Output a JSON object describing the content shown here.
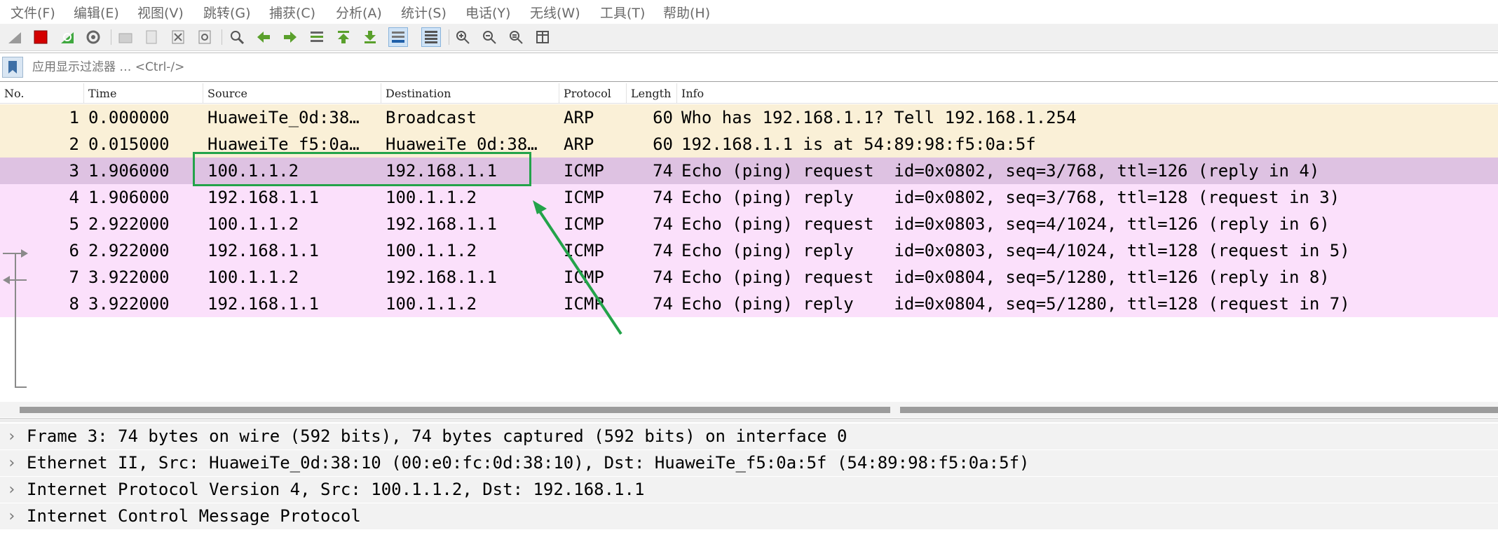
{
  "menu": [
    "文件(F)",
    "编辑(E)",
    "视图(V)",
    "跳转(G)",
    "捕获(C)",
    "分析(A)",
    "统计(S)",
    "电话(Y)",
    "无线(W)",
    "工具(T)",
    "帮助(H)"
  ],
  "toolbar": {
    "icons": [
      "shark-fin-start-icon",
      "stop-capture-icon",
      "restart-capture-icon",
      "capture-options-icon",
      "open-file-icon",
      "save-file-icon",
      "close-file-icon",
      "reload-file-icon",
      "find-packet-icon",
      "go-back-icon",
      "go-forward-icon",
      "go-to-packet-icon",
      "go-first-icon",
      "go-last-icon",
      "autoscroll-icon",
      "colorize-icon",
      "zoom-in-icon",
      "zoom-out-icon",
      "zoom-normal-icon",
      "resize-columns-icon"
    ]
  },
  "filter": {
    "placeholder": "应用显示过滤器 … <Ctrl-/>"
  },
  "columns": [
    "No.",
    "Time",
    "Source",
    "Destination",
    "Protocol",
    "Length",
    "Info"
  ],
  "packets": [
    {
      "no": "1",
      "time": "0.000000",
      "src": "HuaweiTe_0d:38…",
      "dst": "Broadcast",
      "proto": "ARP",
      "len": "60",
      "info": "Who has 192.168.1.1? Tell 192.168.1.254",
      "type": "arp"
    },
    {
      "no": "2",
      "time": "0.015000",
      "src": "HuaweiTe_f5:0a…",
      "dst": "HuaweiTe_0d:38…",
      "proto": "ARP",
      "len": "60",
      "info": "192.168.1.1 is at 54:89:98:f5:0a:5f",
      "type": "arp"
    },
    {
      "no": "3",
      "time": "1.906000",
      "src": "100.1.1.2",
      "dst": "192.168.1.1",
      "proto": "ICMP",
      "len": "74",
      "info": "Echo (ping) request  id=0x0802, seq=3/768, ttl=126 (reply in 4)",
      "type": "sel"
    },
    {
      "no": "4",
      "time": "1.906000",
      "src": "192.168.1.1",
      "dst": "100.1.1.2",
      "proto": "ICMP",
      "len": "74",
      "info": "Echo (ping) reply    id=0x0802, seq=3/768, ttl=128 (request in 3)",
      "type": "icmp"
    },
    {
      "no": "5",
      "time": "2.922000",
      "src": "100.1.1.2",
      "dst": "192.168.1.1",
      "proto": "ICMP",
      "len": "74",
      "info": "Echo (ping) request  id=0x0803, seq=4/1024, ttl=126 (reply in 6)",
      "type": "icmp"
    },
    {
      "no": "6",
      "time": "2.922000",
      "src": "192.168.1.1",
      "dst": "100.1.1.2",
      "proto": "ICMP",
      "len": "74",
      "info": "Echo (ping) reply    id=0x0803, seq=4/1024, ttl=128 (request in 5)",
      "type": "icmp"
    },
    {
      "no": "7",
      "time": "3.922000",
      "src": "100.1.1.2",
      "dst": "192.168.1.1",
      "proto": "ICMP",
      "len": "74",
      "info": "Echo (ping) request  id=0x0804, seq=5/1280, ttl=126 (reply in 8)",
      "type": "icmp"
    },
    {
      "no": "8",
      "time": "3.922000",
      "src": "192.168.1.1",
      "dst": "100.1.1.2",
      "proto": "ICMP",
      "len": "74",
      "info": "Echo (ping) reply    id=0x0804, seq=5/1280, ttl=128 (request in 7)",
      "type": "icmp"
    }
  ],
  "details": [
    "Frame 3: 74 bytes on wire (592 bits), 74 bytes captured (592 bits) on interface 0",
    "Ethernet II, Src: HuaweiTe_0d:38:10 (00:e0:fc:0d:38:10), Dst: HuaweiTe_f5:0a:5f (54:89:98:f5:0a:5f)",
    "Internet Protocol Version 4, Src: 100.1.1.2, Dst: 192.168.1.1",
    "Internet Control Message Protocol"
  ],
  "colors": {
    "arp_row": "#faf0d7",
    "icmp_row": "#fbe0fb",
    "selected_row": "#dec2e2",
    "annotation": "#23a34a"
  }
}
